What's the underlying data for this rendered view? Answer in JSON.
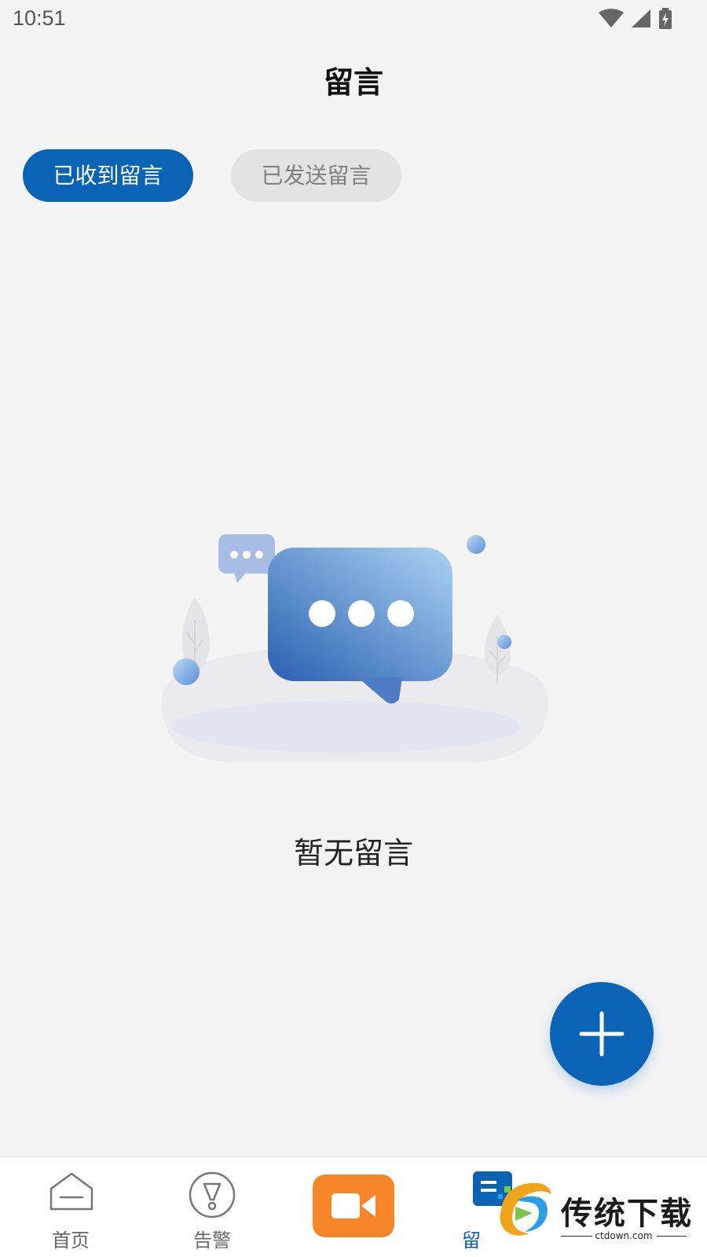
{
  "status_bar": {
    "time": "10:51"
  },
  "header": {
    "title": "留言"
  },
  "tabs": [
    {
      "label": "已收到留言",
      "active": true
    },
    {
      "label": "已发送留言",
      "active": false
    }
  ],
  "empty_state": {
    "text": "暂无留言"
  },
  "fab": {
    "icon": "plus-icon"
  },
  "bottom_nav": {
    "items": [
      {
        "label": "首页",
        "icon": "home-icon",
        "active": false
      },
      {
        "label": "告警",
        "icon": "alarm-icon",
        "active": false
      },
      {
        "label": "",
        "icon": "video-camera-icon",
        "active": false
      },
      {
        "label": "留",
        "icon": "message-icon",
        "active": true
      }
    ]
  },
  "watermark": {
    "title": "传统下载",
    "url": "ctdown.com"
  },
  "colors": {
    "primary": "#0b63b6",
    "video_orange": "#f7862a",
    "background": "#f4f4f5"
  }
}
